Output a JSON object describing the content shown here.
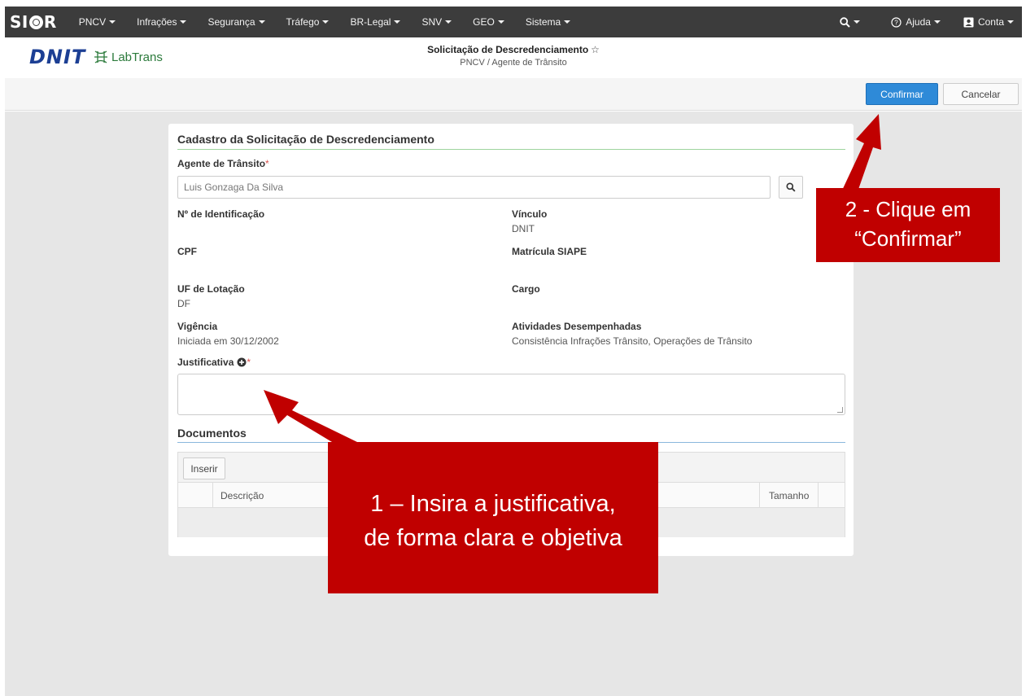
{
  "nav": {
    "brand": "SIOR",
    "brand_prefix": "SI",
    "brand_suffix": "R",
    "menus": [
      "PNCV",
      "Infrações",
      "Segurança",
      "Tráfego",
      "BR-Legal",
      "SNV",
      "GEO",
      "Sistema"
    ],
    "help_label": "Ajuda",
    "account_label": "Conta"
  },
  "header": {
    "logo_dnit": "DNIT",
    "logo_labtrans": "LabTrans",
    "title": "Solicitação de Descredenciamento",
    "breadcrumb": "PNCV / Agente de Trânsito"
  },
  "toolbar": {
    "confirm_label": "Confirmar",
    "cancel_label": "Cancelar"
  },
  "form": {
    "section_title": "Cadastro da Solicitação de Descredenciamento",
    "agent_label": "Agente de Trânsito",
    "required_mark": "*",
    "agent_value": "Luis Gonzaga Da Silva",
    "fields": {
      "id_label": "Nº de Identificação",
      "id_value": "",
      "vinculo_label": "Vínculo",
      "vinculo_value": "DNIT",
      "cpf_label": "CPF",
      "cpf_value": "",
      "matricula_label": "Matrícula SIAPE",
      "matricula_value": "",
      "uf_label": "UF de Lotação",
      "uf_value": "DF",
      "cargo_label": "Cargo",
      "cargo_value": "",
      "vigencia_label": "Vigência",
      "vigencia_value": "Iniciada em 30/12/2002",
      "atividades_label": "Atividades Desempenhadas",
      "atividades_value": "Consistência Infrações Trânsito, Operações de Trânsito"
    },
    "justificativa_label": "Justificativa",
    "justificativa_value": ""
  },
  "documents": {
    "section_title": "Documentos",
    "insert_label": "Inserir",
    "columns": [
      "Descrição",
      "Tamanho"
    ]
  },
  "callouts": {
    "step1_line1": "1 – Insira a justificativa,",
    "step1_line2": "de forma clara e objetiva",
    "step2_line1": "2 - Clique em",
    "step2_line2": "“Confirmar”"
  },
  "colors": {
    "navbar": "#3c3c3c",
    "primary": "#2e8ad8",
    "callout": "#c00000",
    "section_line_green": "#8fcf8f",
    "section_line_blue": "#7fb2d9",
    "dnit_blue": "#1c3f94"
  }
}
